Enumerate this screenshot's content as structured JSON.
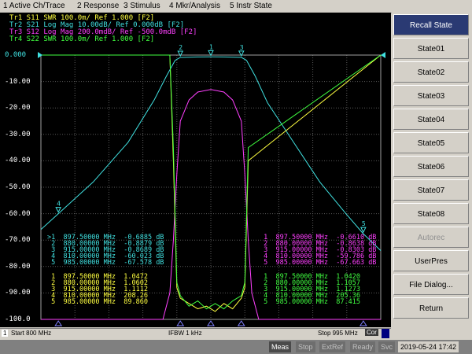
{
  "menu": [
    "1 Active Ch/Trace",
    "2 Response",
    "3 Stimulus",
    "4 Mkr/Analysis",
    "5 Instr State"
  ],
  "traces": [
    {
      "label": "Tr1  S11  SWR 100.0m/ Ref 1.000 [F2]",
      "color": "#ffff40"
    },
    {
      "label": "Tr2  S21  Log Mag 10.00dB/ Ref 0.000dB [F2]",
      "color": "#40e0e0",
      "active_tag": "Tr2"
    },
    {
      "label": "Tr3  S12  Log Mag 200.0mdB/ Ref -500.0mdB [F2]",
      "color": "#ff40ff"
    },
    {
      "label": "Tr4  S22  SWR 100.0m/ Ref 1.000 [F2]",
      "color": "#40ff40"
    }
  ],
  "y_axis_labels": [
    "0.000",
    "-10.00",
    "-20.00",
    "-30.00",
    "-40.00",
    "-50.00",
    "-60.00",
    "-70.00",
    "-80.00",
    "-90.00",
    "-100.0"
  ],
  "marker_tables": {
    "s21": {
      "color": "#40e0e0",
      "rows": [
        {
          "n": "1",
          "freq": "897.50000 MHz",
          "value": "-0.6885 dB",
          "active": true
        },
        {
          "n": "2",
          "freq": "880.00000 MHz",
          "value": "-0.8879 dB"
        },
        {
          "n": "3",
          "freq": "915.00000 MHz",
          "value": "-0.8689 dB"
        },
        {
          "n": "4",
          "freq": "810.00000 MHz",
          "value": "-60.023 dB"
        },
        {
          "n": "5",
          "freq": "985.00000 MHz",
          "value": "-67.578 dB"
        }
      ]
    },
    "s12": {
      "color": "#ff40ff",
      "rows": [
        {
          "n": "1",
          "freq": "897.50000 MHz",
          "value": "-0.6610 dB"
        },
        {
          "n": "2",
          "freq": "880.00000 MHz",
          "value": "-0.8638 dB"
        },
        {
          "n": "3",
          "freq": "915.00000 MHz",
          "value": "-0.8303 dB"
        },
        {
          "n": "4",
          "freq": "810.00000 MHz",
          "value": "-59.786 dB"
        },
        {
          "n": "5",
          "freq": "985.00000 MHz",
          "value": "-67.663 dB"
        }
      ]
    },
    "s11": {
      "color": "#ffff40",
      "rows": [
        {
          "n": "1",
          "freq": "897.50000 MHz",
          "value": "1.0472"
        },
        {
          "n": "2",
          "freq": "880.00000 MHz",
          "value": "1.0602"
        },
        {
          "n": "3",
          "freq": "915.00000 MHz",
          "value": "1.1112"
        },
        {
          "n": "4",
          "freq": "810.00000 MHz",
          "value": "208.26"
        },
        {
          "n": "5",
          "freq": "985.00000 MHz",
          "value": "89.860"
        }
      ]
    },
    "s22": {
      "color": "#40ff40",
      "rows": [
        {
          "n": "1",
          "freq": "897.50000 MHz",
          "value": "1.0420"
        },
        {
          "n": "2",
          "freq": "880.00000 MHz",
          "value": "1.1057"
        },
        {
          "n": "3",
          "freq": "915.00000 MHz",
          "value": "1.1273"
        },
        {
          "n": "4",
          "freq": "810.00000 MHz",
          "value": "205.36"
        },
        {
          "n": "5",
          "freq": "985.00000 MHz",
          "value": "87.415"
        }
      ]
    }
  },
  "bottom": {
    "channel": "1",
    "start": "Start 800 MHz",
    "ifbw": "IFBW 1 kHz",
    "stop": "Stop 995 MHz",
    "cor": "Cor"
  },
  "status": {
    "meas": "Meas",
    "stop": "Stop",
    "extref": "ExtRef",
    "ready": "Ready",
    "svc": "Svc",
    "datetime": "2019-05-24 17:42"
  },
  "side_buttons": [
    "Recall State",
    "State01",
    "State02",
    "State03",
    "State04",
    "State05",
    "State06",
    "State07",
    "State08",
    "Autorec",
    "UserPres",
    "File Dialog...",
    "Return"
  ],
  "chart_data": {
    "type": "line",
    "x_unit": "MHz",
    "xlim": [
      800,
      995
    ],
    "ylim": [
      -100,
      0
    ],
    "grid": true,
    "series": [
      {
        "name": "S21",
        "color": "#40e0e0",
        "x": [
          800,
          810,
          830,
          850,
          865,
          872,
          877,
          880,
          890,
          897.5,
          905,
          915,
          918,
          923,
          930,
          945,
          960,
          975,
          985,
          995
        ],
        "y": [
          -66,
          -60,
          -48,
          -33,
          -17,
          -8,
          -2,
          -0.89,
          -0.7,
          -0.69,
          -0.7,
          -0.87,
          -2,
          -8,
          -18,
          -33,
          -48,
          -60,
          -67.6,
          -74
        ]
      },
      {
        "name": "S12",
        "color": "#ff40ff",
        "x": [
          800,
          870,
          874,
          876,
          878,
          880,
          885,
          890,
          897.5,
          905,
          910,
          915,
          917,
          919,
          921,
          925,
          995
        ],
        "y": [
          -100,
          -100,
          -90,
          -70,
          -45,
          -25,
          -17,
          -14,
          -13,
          -14,
          -17,
          -25,
          -45,
          -70,
          -90,
          -100,
          -100
        ]
      },
      {
        "name": "S11",
        "color": "#ffff40",
        "x": [
          800,
          874,
          876,
          878,
          880,
          885,
          890,
          895,
          900,
          905,
          910,
          915,
          917,
          919,
          995
        ],
        "y": [
          1.0,
          1.0,
          0.6,
          0.12,
          0.08,
          0.06,
          0.04,
          0.05,
          0.03,
          0.06,
          0.04,
          0.08,
          0.12,
          0.6,
          1.0
        ]
      },
      {
        "name": "S22",
        "color": "#40ff40",
        "x": [
          800,
          874,
          876,
          878,
          880,
          885,
          890,
          895,
          900,
          905,
          910,
          915,
          917,
          919,
          995
        ],
        "y": [
          1.0,
          1.0,
          0.65,
          0.14,
          0.09,
          0.05,
          0.07,
          0.04,
          0.06,
          0.04,
          0.07,
          0.09,
          0.14,
          0.65,
          1.0
        ]
      }
    ],
    "markers": [
      {
        "n": "1",
        "x": 897.5
      },
      {
        "n": "2",
        "x": 880
      },
      {
        "n": "3",
        "x": 915
      },
      {
        "n": "4",
        "x": 810
      },
      {
        "n": "5",
        "x": 985
      }
    ]
  }
}
